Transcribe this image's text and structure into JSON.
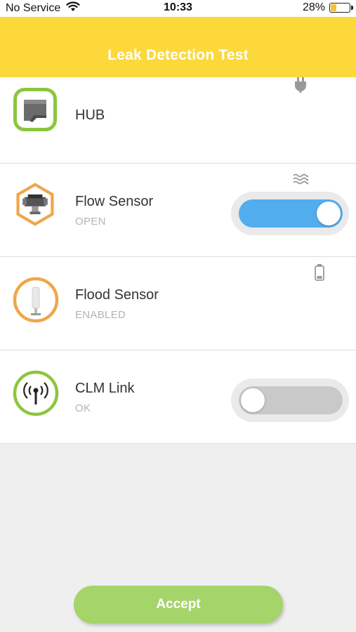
{
  "status_bar": {
    "carrier": "No Service",
    "time": "10:33",
    "battery_percent": "28%",
    "battery_level": 0.28,
    "icons": [
      "wifi-icon",
      "battery-icon"
    ]
  },
  "header": {
    "title": "Leak Detection Test",
    "background_color": "#fcd83b"
  },
  "devices": [
    {
      "name": "HUB",
      "status": "",
      "icon": "hub-device-icon",
      "corner_icon": "power-plug-icon",
      "ring_color": "#8cc63f"
    },
    {
      "name": "Flow Sensor",
      "status": "OPEN",
      "icon": "flow-sensor-device-icon",
      "corner_icon": "water-waves-icon",
      "ring_color": "#f0a64a",
      "toggle_on": true
    },
    {
      "name": "Flood Sensor",
      "status": "ENABLED",
      "icon": "flood-sensor-device-icon",
      "corner_icon": "battery-low-icon",
      "ring_color": "#f0a64a"
    },
    {
      "name": "CLM Link",
      "status": "OK",
      "icon": "antenna-icon",
      "ring_color": "#8cc63f",
      "toggle_on": false
    }
  ],
  "colors": {
    "toggle_on": "#52adef",
    "toggle_off": "#c9c9c9",
    "accept_button": "#a5d46b"
  },
  "accept_button": {
    "label": "Accept"
  }
}
